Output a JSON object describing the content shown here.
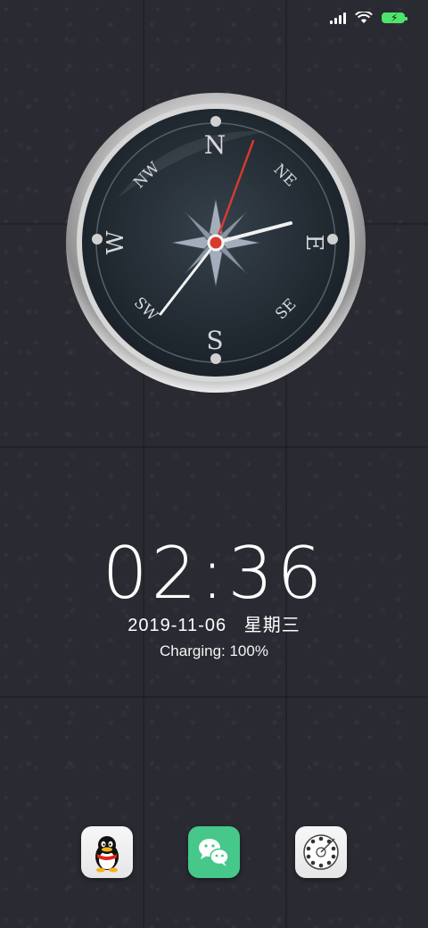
{
  "status_bar": {
    "signal_bars": 4,
    "wifi": "wifi-icon",
    "battery_charging": true,
    "battery_color": "#4ee36a"
  },
  "compass_widget": {
    "labels": {
      "n": "N",
      "ne": "NE",
      "e": "E",
      "se": "SE",
      "s": "S",
      "sw": "SW",
      "w": "W",
      "nw": "NW"
    }
  },
  "lockscreen": {
    "time": "02:36",
    "date": "2019-11-06",
    "weekday": "星期三",
    "charging_label": "Charging: 100%"
  },
  "dock": {
    "apps": [
      {
        "name": "qq",
        "icon": "qq-penguin-icon"
      },
      {
        "name": "wechat",
        "icon": "wechat-icon"
      },
      {
        "name": "phone",
        "icon": "rotary-dial-icon"
      }
    ]
  },
  "colors": {
    "accent_green": "#45c88a",
    "compass_needle_red": "#d83a2e"
  }
}
